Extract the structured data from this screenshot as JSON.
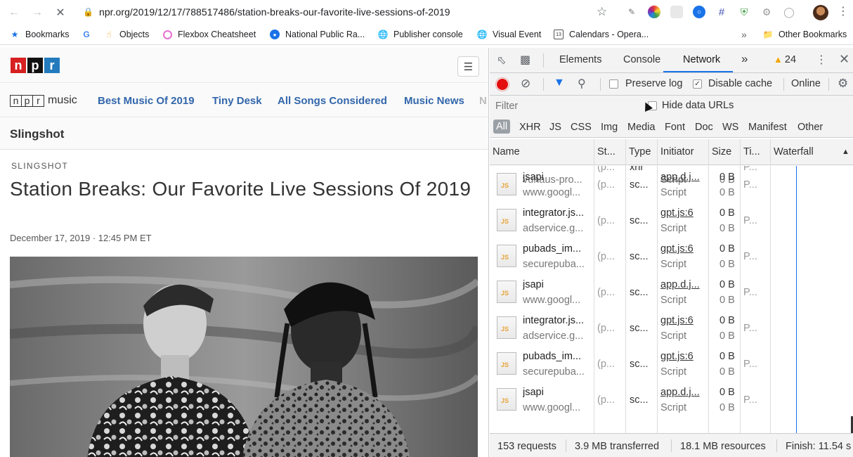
{
  "browser": {
    "url": "npr.org/2019/12/17/788517486/station-breaks-our-favorite-live-sessions-of-2019",
    "bookmarks": [
      {
        "label": "Bookmarks",
        "icon": "star-icon"
      },
      {
        "label": "",
        "icon": "google-icon"
      },
      {
        "label": "Objects",
        "icon": "hand-icon"
      },
      {
        "label": "Flexbox Cheatsheet",
        "icon": "flexbox-icon"
      },
      {
        "label": "National Public Ra...",
        "icon": "npr-icon"
      },
      {
        "label": "Publisher console",
        "icon": "globe-icon"
      },
      {
        "label": "Visual Event",
        "icon": "globe-icon"
      },
      {
        "label": "Calendars - Opera...",
        "icon": "calendar-icon"
      }
    ],
    "other_bookmarks": "Other Bookmarks",
    "more": "»",
    "calendar_day": "13"
  },
  "page": {
    "logo_letters": [
      "n",
      "p",
      "r"
    ],
    "music_logo_letters": [
      "n",
      "p",
      "r"
    ],
    "music_word": "music",
    "nav": [
      "Best Music Of 2019",
      "Tiny Desk",
      "All Songs Considered",
      "Music News",
      "N"
    ],
    "section": "Slingshot",
    "kicker": "SLINGSHOT",
    "headline": "Station Breaks: Our Favorite Live Sessions Of 2019",
    "dateline": "December 17, 2019 · 12:45 PM ET"
  },
  "devtools": {
    "tabs": [
      "Elements",
      "Console",
      "Network"
    ],
    "more_tabs": "»",
    "warnings": "24",
    "toolbar": {
      "preserve_log": "Preserve log",
      "disable_cache": "Disable cache",
      "throttle": "Online"
    },
    "filter": {
      "placeholder": "Filter",
      "hide_data_urls": "Hide data URLs"
    },
    "types": [
      "All",
      "XHR",
      "JS",
      "CSS",
      "Img",
      "Media",
      "Font",
      "Doc",
      "WS",
      "Manifest",
      "Other"
    ],
    "columns": [
      "Name",
      "St...",
      "Type",
      "Initiator",
      "Size",
      "Ti...",
      "Waterfall"
    ],
    "partial_row": {
      "name": "vuhaus-pro...",
      "status": "(p...",
      "type": "xhr",
      "initiator": "Script",
      "size": "0 B",
      "time": "P..."
    },
    "rows": [
      {
        "name": "jsapi",
        "domain": "www.googl...",
        "status": "(p...",
        "type": "sc...",
        "initiator": "app.d.j...",
        "initiator_type": "Script",
        "size": "0 B",
        "size2": "0 B",
        "time": "P..."
      },
      {
        "name": "integrator.js...",
        "domain": "adservice.g...",
        "status": "(p...",
        "type": "sc...",
        "initiator": "gpt.js:6",
        "initiator_type": "Script",
        "size": "0 B",
        "size2": "0 B",
        "time": "P..."
      },
      {
        "name": "pubads_im...",
        "domain": "securepuba...",
        "status": "(p...",
        "type": "sc...",
        "initiator": "gpt.js:6",
        "initiator_type": "Script",
        "size": "0 B",
        "size2": "0 B",
        "time": "P..."
      },
      {
        "name": "jsapi",
        "domain": "www.googl...",
        "status": "(p...",
        "type": "sc...",
        "initiator": "app.d.j...",
        "initiator_type": "Script",
        "size": "0 B",
        "size2": "0 B",
        "time": "P..."
      },
      {
        "name": "integrator.js...",
        "domain": "adservice.g...",
        "status": "(p...",
        "type": "sc...",
        "initiator": "gpt.js:6",
        "initiator_type": "Script",
        "size": "0 B",
        "size2": "0 B",
        "time": "P..."
      },
      {
        "name": "pubads_im...",
        "domain": "securepuba...",
        "status": "(p...",
        "type": "sc...",
        "initiator": "gpt.js:6",
        "initiator_type": "Script",
        "size": "0 B",
        "size2": "0 B",
        "time": "P..."
      },
      {
        "name": "jsapi",
        "domain": "www.googl...",
        "status": "(p...",
        "type": "sc...",
        "initiator": "app.d.j...",
        "initiator_type": "Script",
        "size": "0 B",
        "size2": "0 B",
        "time": "P..."
      }
    ],
    "status": {
      "requests": "153 requests",
      "transferred": "3.9 MB transferred",
      "resources": "18.1 MB resources",
      "finish": "Finish: 11.54 s"
    },
    "file_badge": "JS"
  }
}
